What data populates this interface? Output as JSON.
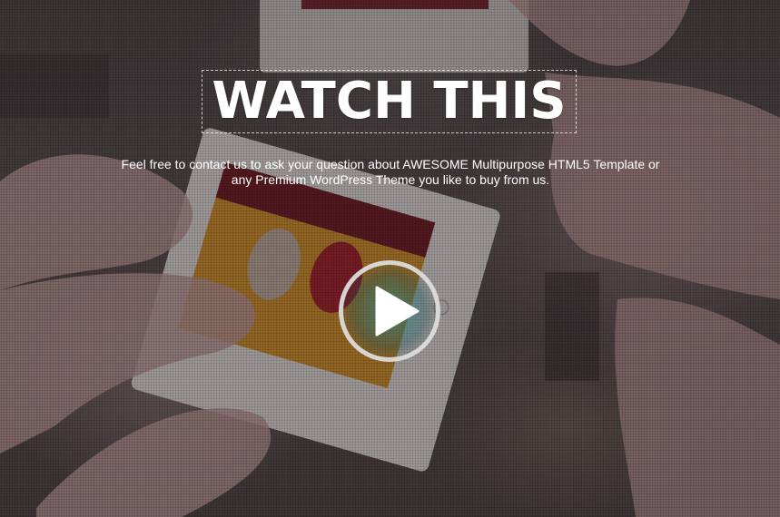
{
  "hero": {
    "title": "WATCH THIS",
    "subtitle_line1": "Feel free to contact us to ask your question about AWESOME Multipurpose HTML5 Template or",
    "subtitle_line2": "any Premium WordPress Theme you like to buy from us."
  },
  "play_button": {
    "icon": "play-icon"
  },
  "colors": {
    "text": "#ffffff",
    "play_glow": "#288c8c",
    "ring": "#dcdcdc"
  }
}
